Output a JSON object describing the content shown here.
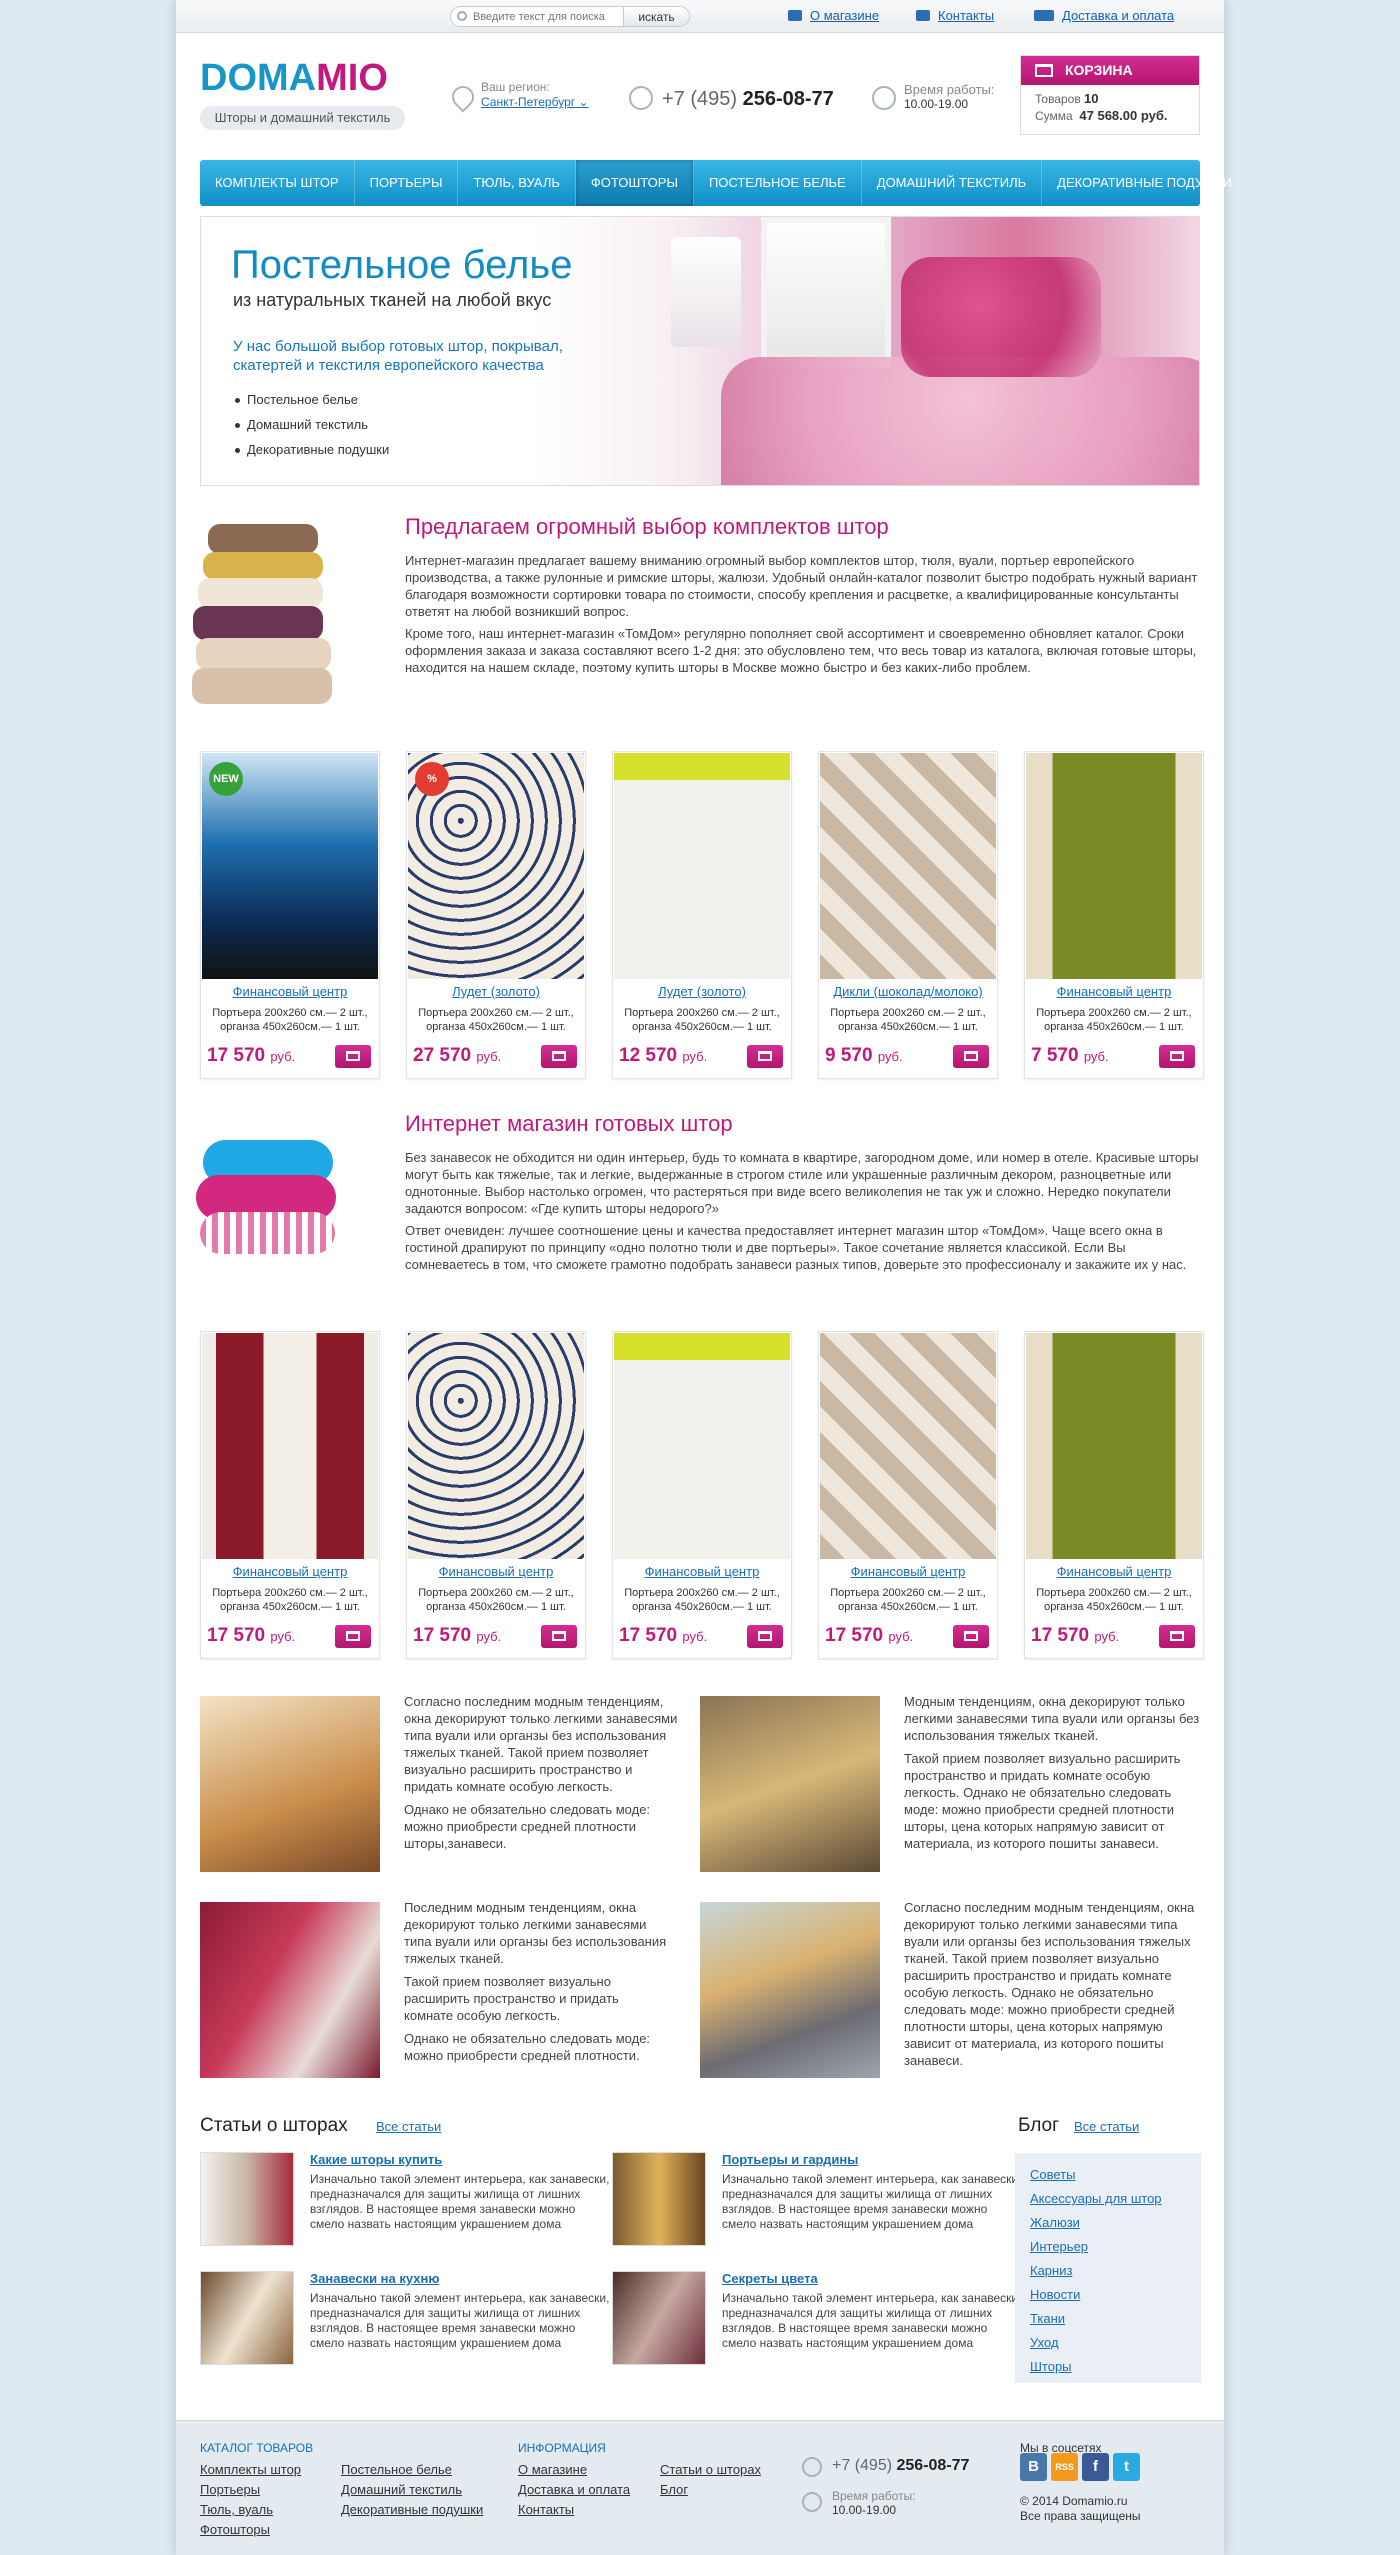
{
  "topbar": {
    "search_placeholder": "Введите текст для поиска",
    "search_button": "искать",
    "links": [
      "О магазине",
      "Контакты",
      "Доставка и оплата"
    ]
  },
  "header": {
    "logo_part1": "DOMA",
    "logo_part2": "MIO",
    "slogan": "Шторы и домашний текстиль",
    "region_label": "Ваш регион:",
    "region_value": "Санкт-Петербург",
    "phone_prefix": "+7 (495)",
    "phone_number": "256-08-77",
    "work_label": "Время работы:",
    "work_hours": "10.00-19.00",
    "cart_title": "КОРЗИНА",
    "cart_items_label": "Товаров",
    "cart_items": "10",
    "cart_sum_label": "Сумма",
    "cart_sum": "47 568.00 руб."
  },
  "nav": [
    "Комплекты штор",
    "Портьеры",
    "Тюль, вуаль",
    "Фотошторы",
    "Постельное белье",
    "Домашний текстиль",
    "Декоративные подушки"
  ],
  "banner": {
    "title": "Постельное белье",
    "subtitle": "из натуральных тканей на любой вкус",
    "description": "У нас большой выбор готовых штор, покрывал, скатертей и текстиля европейского качества",
    "list": [
      "Постельное белье",
      "Домашний текстиль",
      "Декоративные подушки"
    ]
  },
  "section1": {
    "title": "Предлагаем огромный выбор комплектов штор",
    "p1": "Интернет-магазин предлагает вашему вниманию огромный выбор комплектов штор, тюля, вуали, портьер европейского производства, а также рулонные и римские шторы, жалюзи. Удобный онлайн-каталог позволит быстро подобрать нужный вариант благодаря возможности сортировки товара по стоимости, способу крепления и расцветке, а квалифицированные консультанты ответят на любой возникший вопрос.",
    "p2": "Кроме того, наш интернет-магазин «ТомДом» регулярно пополняет свой ассортимент и своевременно обновляет каталог. Сроки оформления заказа и заказа составляют всего 1-2 дня: это обусловлено тем, что весь товар из каталога, включая готовые шторы, находится на нашем складе, поэтому купить шторы в Москве можно быстро и без каких-либо проблем."
  },
  "products1": [
    {
      "name": "Финансовый центр",
      "desc": "Портьера 200x260 см.— 2 шт., органза 450x260см.— 1 шт.",
      "price": "17 570",
      "currency": "руб.",
      "badge": "NEW"
    },
    {
      "name": "Лудет (золото)",
      "desc": "Портьера 200x260 см.— 2 шт., органза 450x260см.— 1 шт.",
      "price": "27 570",
      "currency": "руб.",
      "badge": "%"
    },
    {
      "name": "Лудет (золото)",
      "desc": "Портьера 200x260 см.— 2 шт., органза 450x260см.— 1 шт.",
      "price": "12 570",
      "currency": "руб.",
      "badge": ""
    },
    {
      "name": "Дикли (шоколад/молоко)",
      "desc": "Портьера 200x260 см.— 2 шт., органза 450x260см.— 1 шт.",
      "price": "9 570",
      "currency": "руб.",
      "badge": ""
    },
    {
      "name": "Финансовый центр",
      "desc": "Портьера 200x260 см.— 2 шт., органза 450x260см.— 1 шт.",
      "price": "7 570",
      "currency": "руб.",
      "badge": ""
    }
  ],
  "section2": {
    "title": "Интернет магазин готовых штор",
    "p1": "Без занавесок не обходится ни один интерьер, будь то комната в квартире, загородном доме, или номер в отеле. Красивые шторы могут быть как тяжелые, так и легкие, выдержанные в строгом стиле или украшенные различным декором, разноцветные или однотонные. Выбор настолько огромен, что растеряться при виде всего великолепия не так уж и сложно. Нередко покупатели задаются вопросом: «Где купить шторы недорого?»",
    "p2": "Ответ очевиден: лучшее соотношение цены и качества предоставляет интернет магазин штор «ТомДом». Чаще всего окна в гостиной драпируют по принципу «одно полотно тюли и две портьеры». Такое сочетание является классикой. Если Вы сомневаетесь в том, что сможете грамотно подобрать занавеси разных типов, доверьте это профессионалу и закажите их у нас."
  },
  "products2": [
    {
      "name": "Финансовый центр",
      "desc": "Портьера 200x260 см.— 2 шт., органза 450x260см.— 1 шт.",
      "price": "17 570",
      "currency": "руб."
    },
    {
      "name": "Финансовый центр",
      "desc": "Портьера 200x260 см.— 2 шт., органза 450x260см.— 1 шт.",
      "price": "17 570",
      "currency": "руб."
    },
    {
      "name": "Финансовый центр",
      "desc": "Портьера 200x260 см.— 2 шт., органза 450x260см.— 1 шт.",
      "price": "17 570",
      "currency": "руб."
    },
    {
      "name": "Финансовый центр",
      "desc": "Портьера 200x260 см.— 2 шт., органза 450x260см.— 1 шт.",
      "price": "17 570",
      "currency": "руб."
    },
    {
      "name": "Финансовый центр",
      "desc": "Портьера 200x260 см.— 2 шт., органза 450x260см.— 1 шт.",
      "price": "17 570",
      "currency": "руб."
    }
  ],
  "articles": [
    {
      "p": [
        "Согласно последним модным тенденциям, окна декорируют только легкими занавесями типа вуали или органзы без использования тяжелых тканей. Такой прием позволяет визуально расширить пространство и придать комнате особую легкость.",
        "Однако не обязательно следовать моде: можно приобрести средней плотности шторы,занавеси."
      ]
    },
    {
      "p": [
        "Модным тенденциям, окна декорируют только легкими занавесями типа вуали или органзы без использования тяжелых тканей.",
        "Такой прием позволяет визуально расширить пространство и придать комнате особую легкость. Однако не обязательно следовать моде: можно приобрести средней плотности шторы, цена которых напрямую зависит от материала, из которого пошиты занавеси."
      ]
    },
    {
      "p": [
        "Последним модным тенденциям, окна декорируют только легкими занавесями типа вуали или органзы без использования тяжелых тканей.",
        "Такой прием позволяет визуально расширить пространство и придать комнате особую легкость.",
        "Однако не обязательно следовать моде: можно приобрести средней плотности."
      ]
    },
    {
      "p": [
        "Согласно последним модным тенденциям, окна декорируют только легкими занавесями типа вуали или органзы без использования тяжелых тканей. Такой прием позволяет визуально расширить пространство и придать комнате особую легкость. Однако не обязательно следовать моде: можно приобрести средней плотности шторы, цена которых напрямую зависит от материала, из которого пошиты занавеси."
      ]
    }
  ],
  "articles_block": {
    "title": "Статьи о шторах",
    "all": "Все статьи",
    "items": [
      {
        "title": "Какие шторы купить",
        "text": "Изначально такой элемент интерьера, как занавески, предназначался для защиты жилища от лишних взглядов. В настоящее время занавески можно смело назвать настоящим украшением дома"
      },
      {
        "title": "Портьеры и гардины",
        "text": "Изначально такой элемент интерьера, как занавески, предназначался для защиты жилища от лишних взглядов. В настоящее время занавески можно смело назвать настоящим украшением дома"
      },
      {
        "title": "Занавески на кухню",
        "text": "Изначально такой элемент интерьера, как занавески, предназначался для защиты жилища от лишних взглядов. В настоящее время занавески можно смело назвать настоящим украшением дома"
      },
      {
        "title": "Секреты цвета",
        "text": "Изначально такой элемент интерьера, как занавески, предназначался для защиты жилища от лишних взглядов. В настоящее время занавески можно смело назвать настоящим украшением дома"
      }
    ]
  },
  "blog": {
    "title": "Блог",
    "all": "Все статьи",
    "items": [
      "Советы",
      "Аксессуары для штор",
      "Жалюзи",
      "Интерьер",
      "Карниз",
      "Новости",
      "Ткани",
      "Уход",
      "Шторы"
    ]
  },
  "footer": {
    "catalog_title": "Каталог товаров",
    "catalog_col1": [
      "Комплекты штор",
      "Портьеры",
      "Тюль, вуаль",
      "Фотошторы"
    ],
    "catalog_col2": [
      "Постельное белье",
      "Домашний текстиль",
      "Декоративные подушки"
    ],
    "info_title": "Информация",
    "info_col1": [
      "О магазине",
      "Доставка и  оплата",
      "Контакты"
    ],
    "info_col2": [
      "Статьи о шторах",
      "Блог"
    ],
    "phone_prefix": "+7 (495)",
    "phone_number": "256-08-77",
    "work_label": "Время работы:",
    "work_hours": "10.00-19.00",
    "social_title": "Мы в соцсетях",
    "social": [
      "В",
      "RSS",
      "f",
      "t"
    ],
    "copyright": "© 2014  Domamio.ru",
    "rights": "Все права защищены"
  },
  "colors": {
    "accent": "#c2187d",
    "brand_blue": "#1796c9",
    "nav": "#1a9fd6"
  }
}
